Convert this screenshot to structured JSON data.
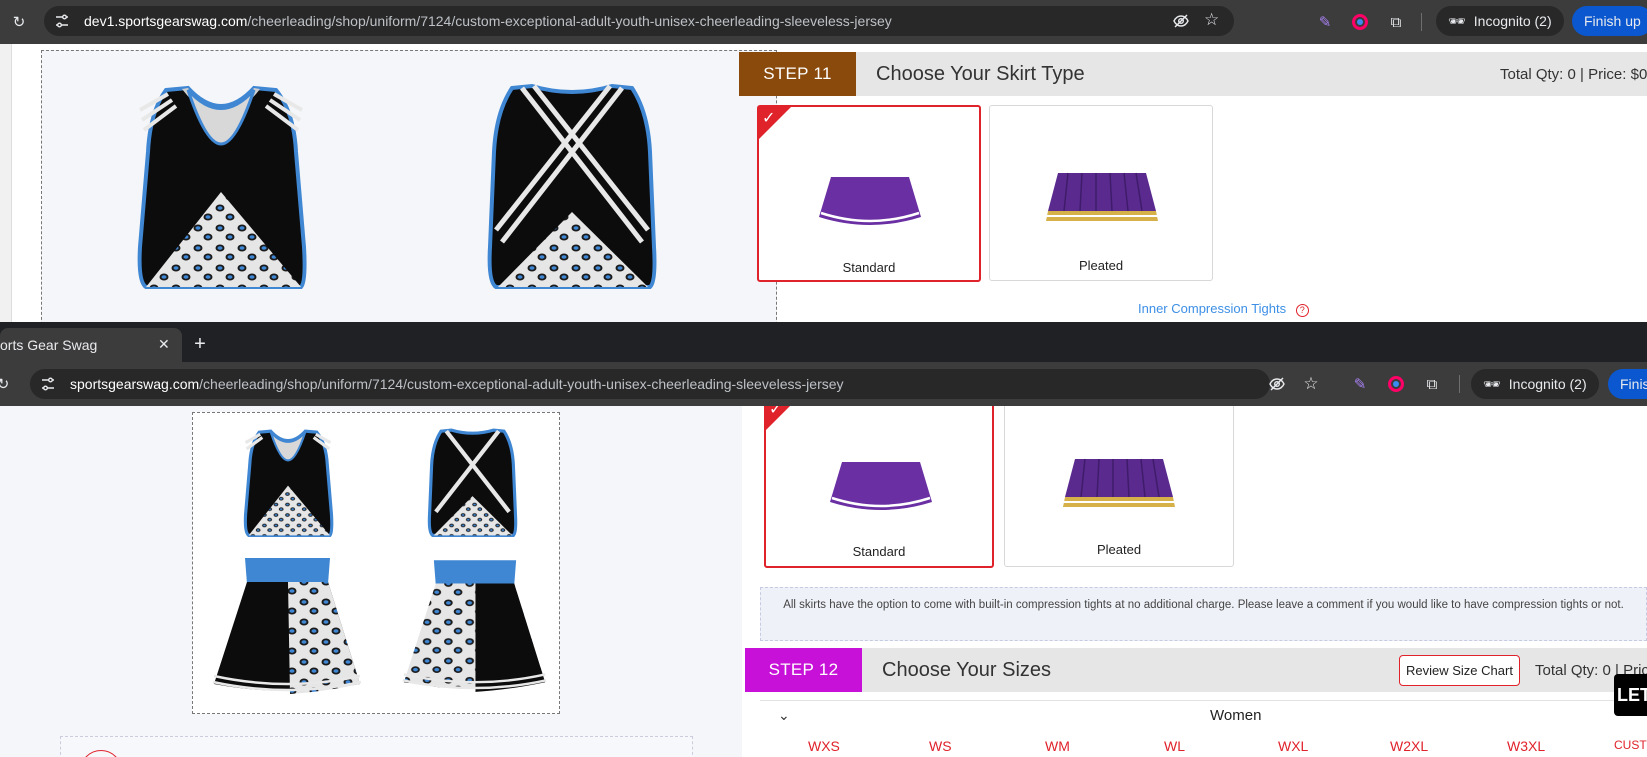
{
  "top_window": {
    "url_host": "dev1.sportsgearswag.com",
    "url_path": "/cheerleading/shop/uniform/7124/custom-exceptional-adult-youth-unisex-cheerleading-sleeveless-jersey",
    "incognito_label": "Incognito (2)",
    "finish_label": "Finish up"
  },
  "bottom_window": {
    "tab_title": "orts Gear Swag",
    "url_host": "sportsgearswag.com",
    "url_path": "/cheerleading/shop/uniform/7124/custom-exceptional-adult-youth-unisex-cheerleading-sleeveless-jersey",
    "incognito_label": "Incognito (2)",
    "finish_label": "Finis"
  },
  "step11": {
    "tab_label": "STEP 11",
    "tab_color": "#8a4a0c",
    "title": "Choose Your Skirt Type",
    "meta": "Total Qty: 0 | Price: $0",
    "options": [
      {
        "label": "Standard",
        "selected": true
      },
      {
        "label": "Pleated",
        "selected": false
      }
    ],
    "inner_tights_link": "Inner Compression Tights",
    "note": "All skirts have the option to come with built-in compression tights at no additional charge. Please leave a comment if you would like to have compression tights or not."
  },
  "step12": {
    "tab_label": "STEP 12",
    "tab_color": "#c811d8",
    "title": "Choose Your Sizes",
    "review_button": "Review Size Chart",
    "meta": "Total Qty: 0 | Pric",
    "group_label": "Women",
    "sizes": [
      "WXS",
      "WS",
      "WM",
      "WL",
      "WXL",
      "W2XL",
      "W3XL",
      "CUSTO"
    ]
  },
  "chat_badge": "LET",
  "colors": {
    "accent_red": "#e0222b",
    "skirt_purple": "#6a2fa3",
    "link_blue": "#3d8fe6",
    "uniform_blue": "#3f86d3"
  }
}
